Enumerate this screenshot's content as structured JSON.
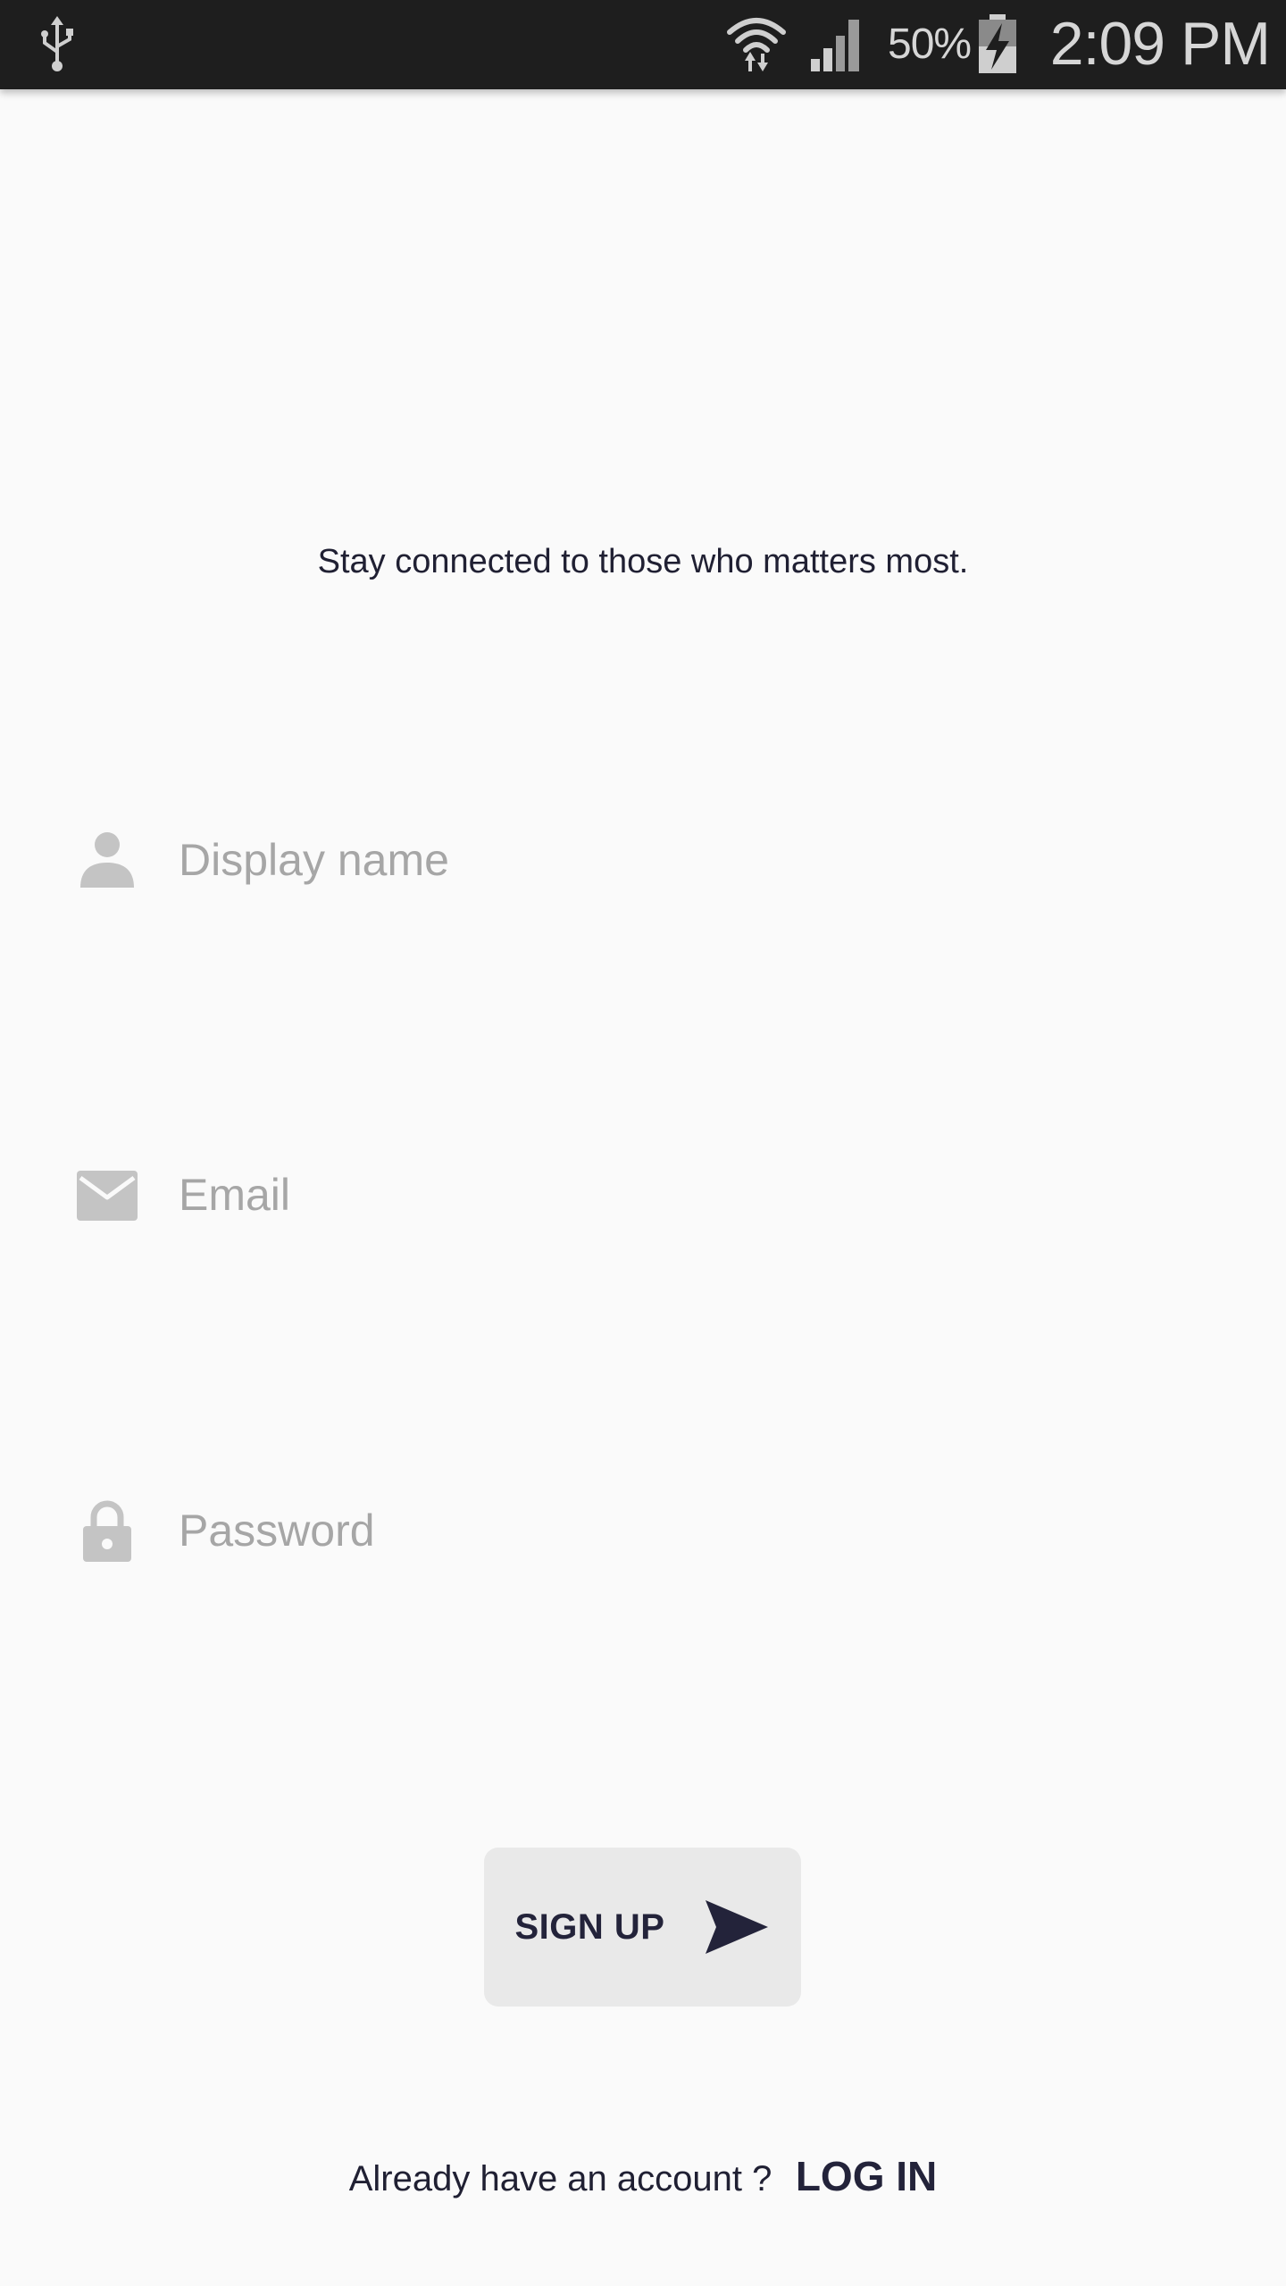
{
  "status_bar": {
    "battery_percent": "50%",
    "time": "2:09 PM",
    "icons": [
      "usb-icon",
      "wifi-icon",
      "cell-signal-icon",
      "battery-charging-icon"
    ]
  },
  "tagline": "Stay connected to those who matters most.",
  "form": {
    "display_name": {
      "placeholder": "Display name",
      "value": "",
      "icon": "person-icon"
    },
    "email": {
      "placeholder": "Email",
      "value": "",
      "icon": "mail-icon"
    },
    "password": {
      "placeholder": "Password",
      "value": "",
      "icon": "lock-icon"
    }
  },
  "signup_button": {
    "label": "SIGN UP",
    "icon": "send-icon"
  },
  "login": {
    "prompt": "Already have an account ?",
    "link_label": "LOG IN"
  },
  "colors": {
    "background": "#fafafa",
    "status_bar": "#1e1e1e",
    "text_dark": "#23233a",
    "icon_gray": "#c4c4c4",
    "placeholder": "#a6a6a6",
    "button_bg": "#e9e9e9"
  }
}
